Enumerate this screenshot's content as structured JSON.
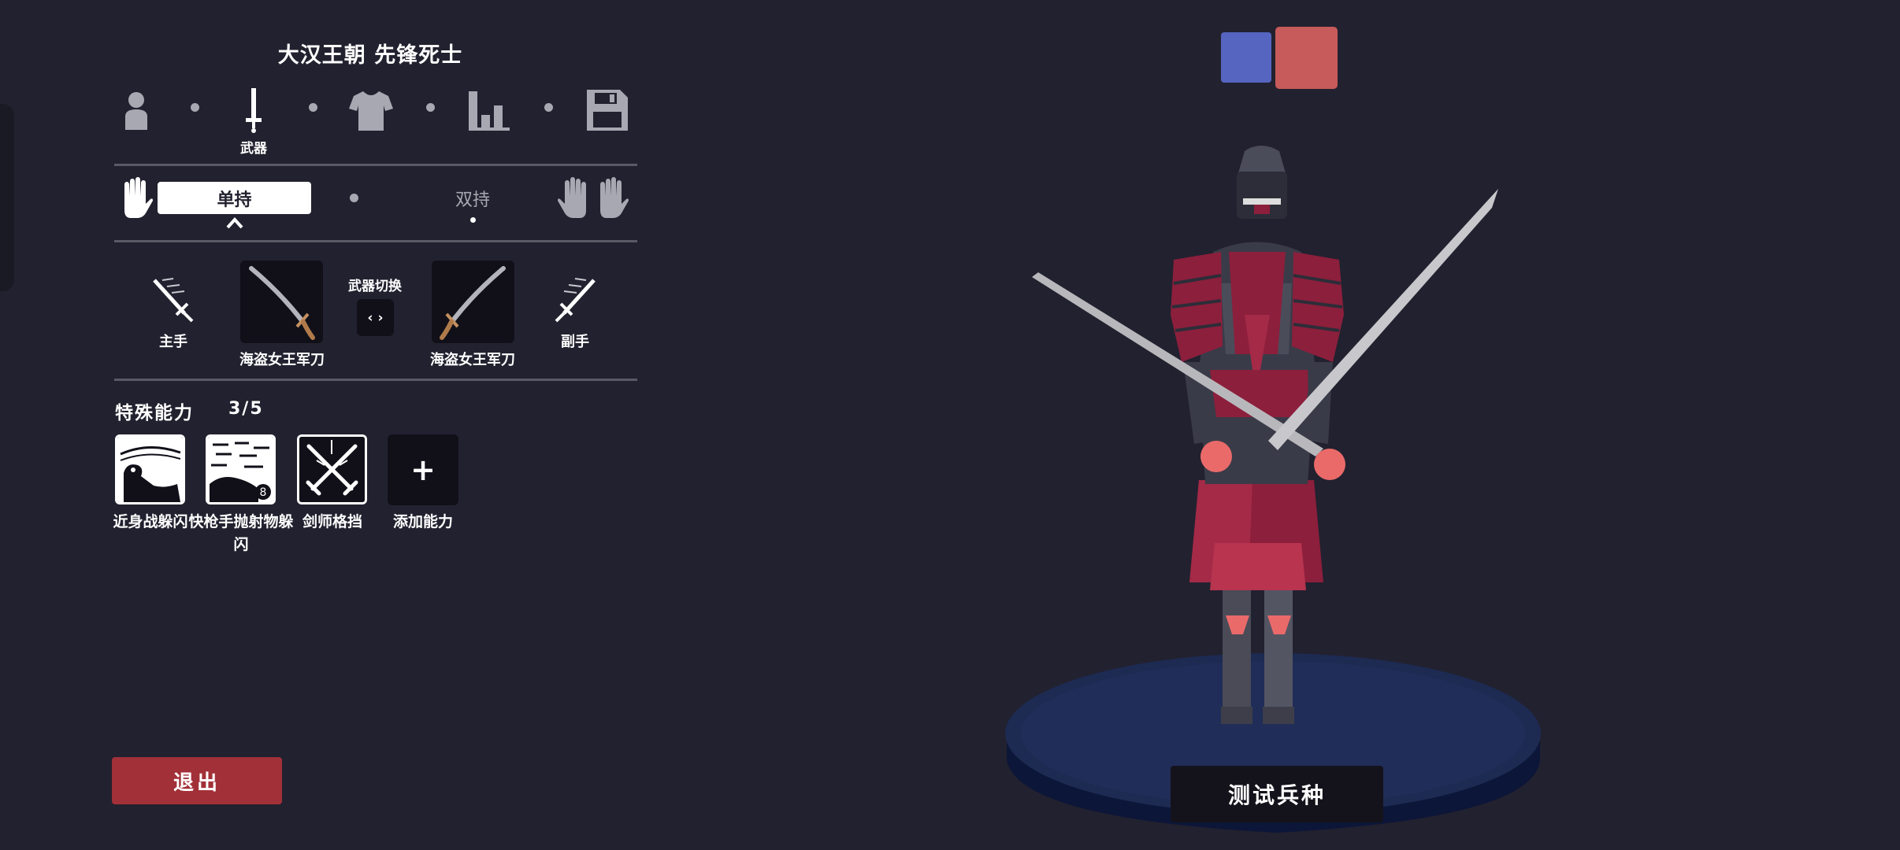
{
  "unit": {
    "title": "大汉王朝 先锋死士"
  },
  "steps": [
    {
      "icon": "person-icon",
      "label": ""
    },
    {
      "icon": "sword-icon",
      "label": "武器"
    },
    {
      "icon": "shirt-icon",
      "label": ""
    },
    {
      "icon": "stats-icon",
      "label": ""
    },
    {
      "icon": "save-icon",
      "label": ""
    }
  ],
  "grip": {
    "single": "单持",
    "dual": "双持",
    "selected": "single"
  },
  "weapons": {
    "main_hand_label": "主手",
    "off_hand_label": "副手",
    "main_weapon": "海盗女王军刀",
    "off_weapon": "海盗女王军刀",
    "switch_label": "武器切换",
    "switch_icon": "‹ ›"
  },
  "abilities": {
    "title": "特殊能力",
    "count": "3/5",
    "items": [
      {
        "icon": "melee-dodge-icon",
        "label": "近身战躲闪"
      },
      {
        "icon": "gunslinger-dodge-icon",
        "label": "快枪手抛射物躲闪"
      },
      {
        "icon": "crossed-swords-icon",
        "label": "剑师格挡"
      }
    ],
    "add_label": "添加能力",
    "add_symbol": "+"
  },
  "buttons": {
    "exit": "退出",
    "test": "测试兵种"
  },
  "team_colors": {
    "blue": "#5565c0",
    "red": "#c75a5a"
  }
}
